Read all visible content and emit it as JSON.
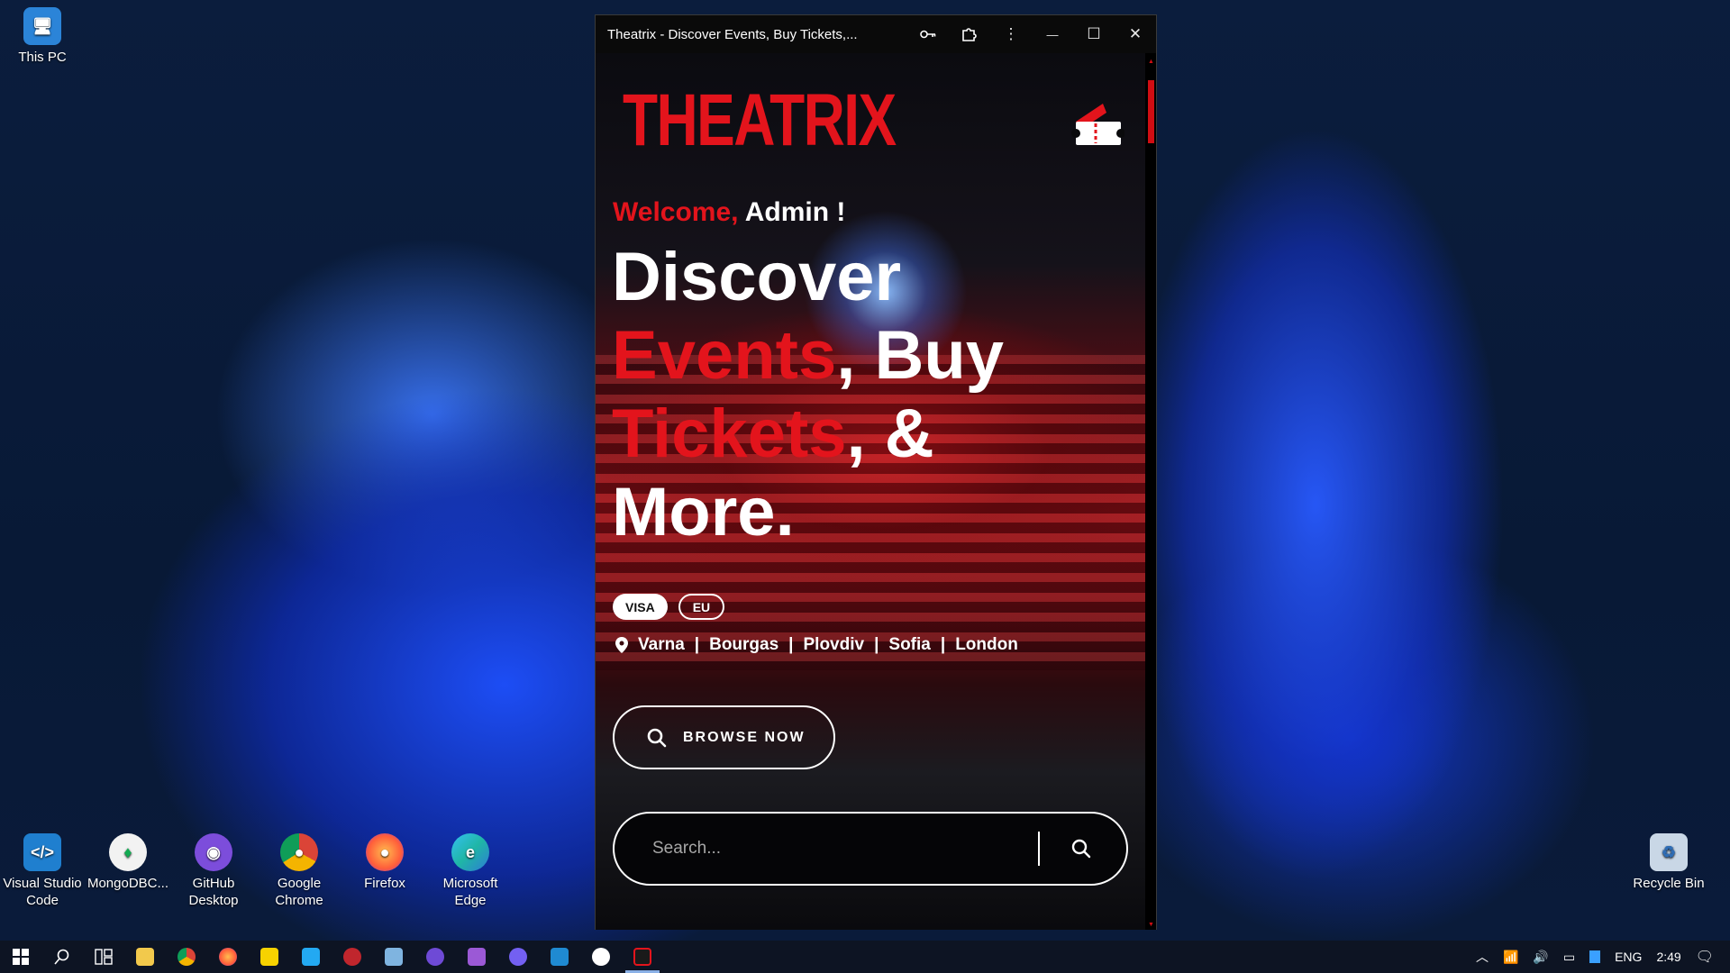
{
  "desktop": {
    "top_icons": [
      {
        "label": "This PC",
        "icon": "this-pc-icon"
      }
    ],
    "bottom_icons": [
      {
        "label": "Visual Studio Code",
        "icon": "vscode-icon",
        "color": "#23a9f2"
      },
      {
        "label": "MongoDBC...",
        "icon": "mongodb-compass-icon",
        "color": "#ffffff"
      },
      {
        "label": "GitHub Desktop",
        "icon": "github-desktop-icon",
        "color": "#8b5cf6"
      },
      {
        "label": "Google Chrome",
        "icon": "chrome-icon",
        "color": "#f4b400"
      },
      {
        "label": "Firefox",
        "icon": "firefox-icon",
        "color": "#ff7139"
      },
      {
        "label": "Microsoft Edge",
        "icon": "edge-icon",
        "color": "#1fb6a6"
      }
    ],
    "recycle_bin": {
      "label": "Recycle Bin",
      "icon": "recycle-bin-icon"
    }
  },
  "window": {
    "title": "Theatrix - Discover Events, Buy Tickets,...",
    "buttons": {
      "key": "key-icon",
      "extensions": "puzzle-icon",
      "more": "⋮",
      "minimize": "—",
      "maximize": "☐",
      "close": "✕"
    }
  },
  "app": {
    "logo": "THEATRIX",
    "welcome_prefix": "Welcome,",
    "welcome_name": "Admin !",
    "headline": {
      "line1": "Discover",
      "line2_red": "Events",
      "line2_white": ", Buy",
      "line3_red": "Tickets",
      "line3_white": ", &",
      "line4": "More."
    },
    "badges": [
      "VISA",
      "EU"
    ],
    "cities": [
      "Varna",
      "Bourgas",
      "Plovdiv",
      "Sofia",
      "London"
    ],
    "city_separator": "|",
    "browse_button": "BROWSE NOW",
    "search_placeholder": "Search..."
  },
  "colors": {
    "brand_red": "#e3141c",
    "window_bg": "#0a0a0c",
    "taskbar_bg": "#0d1423"
  },
  "taskbar": {
    "items": [
      {
        "icon": "start-icon",
        "active": false
      },
      {
        "icon": "search-icon",
        "active": false
      },
      {
        "icon": "task-view-icon",
        "active": false
      },
      {
        "icon": "file-explorer-icon",
        "active": false
      },
      {
        "icon": "chrome-icon",
        "active": false
      },
      {
        "icon": "firefox-icon",
        "active": false
      },
      {
        "icon": "notes-icon",
        "active": false
      },
      {
        "icon": "vscode-icon",
        "active": false
      },
      {
        "icon": "bug-app-icon",
        "active": false
      },
      {
        "icon": "image-app-icon",
        "active": false
      },
      {
        "icon": "github-icon",
        "active": false
      },
      {
        "icon": "visual-studio-icon",
        "active": false
      },
      {
        "icon": "viber-icon",
        "active": false
      },
      {
        "icon": "vscode-icon",
        "active": false
      },
      {
        "icon": "app-icon",
        "active": false
      },
      {
        "icon": "theatrix-window-icon",
        "active": true
      }
    ],
    "tray": {
      "language": "ENG",
      "time": "2:49"
    }
  }
}
